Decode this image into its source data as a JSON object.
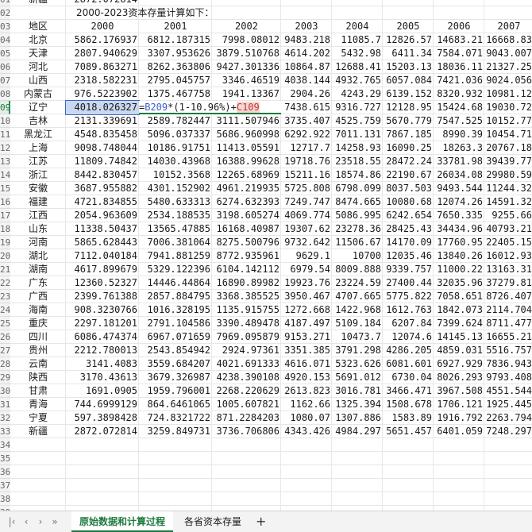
{
  "sheet": {
    "partial_top_row": {
      "rowlabel": "01",
      "cells": [
        "新疆",
        "2872.072814"
      ]
    },
    "title": "2000-2023资本存量计算如下：",
    "header": [
      "地区",
      "2000",
      "2001",
      "2002",
      "2003",
      "2004",
      "2005",
      "2006",
      "2007"
    ],
    "active_row": "09",
    "formula": {
      "a": "=",
      "b": "B209",
      "c": "*(1-10.96%)+",
      "d": "C109"
    },
    "rows": [
      {
        "n": "04",
        "cells": [
          "北京",
          "5862.176937",
          "6812.187315",
          "7998.08012",
          "9483.218",
          "11085.7",
          "12826.57",
          "14683.21",
          "16668.83"
        ]
      },
      {
        "n": "05",
        "cells": [
          "天津",
          "2807.940629",
          "3307.953626",
          "3879.510768",
          "4614.202",
          "5432.98",
          "6411.34",
          "7584.071",
          "9043.007"
        ]
      },
      {
        "n": "06",
        "cells": [
          "河北",
          "7089.863271",
          "8262.363806",
          "9427.301336",
          "10864.87",
          "12688.41",
          "15203.13",
          "18036.11",
          "21327.25"
        ]
      },
      {
        "n": "07",
        "cells": [
          "山西",
          "2318.582231",
          "2795.045757",
          "3346.46519",
          "4038.144",
          "4932.765",
          "6057.084",
          "7421.036",
          "9024.056"
        ]
      },
      {
        "n": "08",
        "cells": [
          "内蒙古",
          "976.5223902",
          "1375.467758",
          "1941.13367",
          "2904.26",
          "4243.29",
          "6139.152",
          "8320.932",
          "10981.12"
        ]
      },
      {
        "n": "09",
        "cells": [
          "辽宁",
          "4018.026327",
          "",
          "",
          "7438.615",
          "9316.727",
          "12128.95",
          "15424.68",
          "19030.72"
        ]
      },
      {
        "n": "10",
        "cells": [
          "吉林",
          "2131.339691",
          "2589.782447",
          "3111.507946",
          "3735.407",
          "4525.759",
          "5670.779",
          "7547.525",
          "10152.77"
        ]
      },
      {
        "n": "11",
        "cells": [
          "黑龙江",
          "4548.835458",
          "5096.037337",
          "5686.960998",
          "6292.922",
          "7011.131",
          "7867.185",
          "8990.39",
          "10454.71"
        ]
      },
      {
        "n": "12",
        "cells": [
          "上海",
          "9098.748044",
          "10186.91751",
          "11413.05591",
          "12717.7",
          "14258.93",
          "16090.25",
          "18263.3",
          "20767.18"
        ]
      },
      {
        "n": "13",
        "cells": [
          "江苏",
          "11809.74842",
          "14030.43968",
          "16388.99628",
          "19718.76",
          "23518.55",
          "28472.24",
          "33781.98",
          "39439.77"
        ]
      },
      {
        "n": "14",
        "cells": [
          "浙江",
          "8442.830457",
          "10152.3568",
          "12265.68969",
          "15211.16",
          "18574.86",
          "22190.67",
          "26034.08",
          "29980.59"
        ]
      },
      {
        "n": "15",
        "cells": [
          "安徽",
          "3687.955882",
          "4301.152902",
          "4961.219935",
          "5725.808",
          "6798.099",
          "8037.503",
          "9493.544",
          "11244.32"
        ]
      },
      {
        "n": "16",
        "cells": [
          "福建",
          "4721.834855",
          "5480.633313",
          "6274.632393",
          "7249.747",
          "8474.665",
          "10080.68",
          "12074.26",
          "14591.32"
        ]
      },
      {
        "n": "17",
        "cells": [
          "江西",
          "2054.963609",
          "2534.188535",
          "3198.605274",
          "4069.774",
          "5086.995",
          "6242.654",
          "7650.335",
          "9255.66"
        ]
      },
      {
        "n": "18",
        "cells": [
          "山东",
          "11338.50437",
          "13565.47885",
          "16168.40987",
          "19307.62",
          "23278.36",
          "28425.43",
          "34434.96",
          "40793.21"
        ]
      },
      {
        "n": "19",
        "cells": [
          "河南",
          "5865.628443",
          "7006.381064",
          "8275.500796",
          "9732.642",
          "11506.67",
          "14170.09",
          "17760.95",
          "22405.15"
        ]
      },
      {
        "n": "20",
        "cells": [
          "湖北",
          "7112.040184",
          "7941.881259",
          "8772.935961",
          "9629.1",
          "10700",
          "12035.46",
          "13840.26",
          "16012.93"
        ]
      },
      {
        "n": "21",
        "cells": [
          "湖南",
          "4617.899679",
          "5329.122396",
          "6104.142112",
          "6979.54",
          "8009.888",
          "9339.757",
          "11000.22",
          "13163.31"
        ]
      },
      {
        "n": "22",
        "cells": [
          "广东",
          "12360.52327",
          "14446.44864",
          "16890.89982",
          "19923.76",
          "23224.59",
          "27400.44",
          "32035.96",
          "37279.81"
        ]
      },
      {
        "n": "23",
        "cells": [
          "广西",
          "2399.761388",
          "2857.884795",
          "3368.385525",
          "3950.467",
          "4707.665",
          "5775.822",
          "7058.651",
          "8726.407"
        ]
      },
      {
        "n": "24",
        "cells": [
          "海南",
          "908.3230766",
          "1016.328195",
          "1135.915755",
          "1272.668",
          "1422.968",
          "1612.763",
          "1842.073",
          "2114.704"
        ]
      },
      {
        "n": "25",
        "cells": [
          "重庆",
          "2297.181201",
          "2791.104586",
          "3390.489478",
          "4187.497",
          "5109.184",
          "6207.84",
          "7399.624",
          "8711.477"
        ]
      },
      {
        "n": "26",
        "cells": [
          "四川",
          "6086.474374",
          "6967.071659",
          "7969.095879",
          "9153.271",
          "10473.7",
          "12074.6",
          "14145.13",
          "16655.21"
        ]
      },
      {
        "n": "27",
        "cells": [
          "贵州",
          "2212.780013",
          "2543.854942",
          "2924.97361",
          "3351.385",
          "3791.298",
          "4286.205",
          "4859.031",
          "5516.757"
        ]
      },
      {
        "n": "28",
        "cells": [
          "云南",
          "3141.4083",
          "3559.684207",
          "4021.691333",
          "4616.071",
          "5323.626",
          "6081.601",
          "6927.929",
          "7836.943"
        ]
      },
      {
        "n": "29",
        "cells": [
          "陕西",
          "3170.43613",
          "3679.326987",
          "4238.390108",
          "4920.153",
          "5691.012",
          "6730.04",
          "8026.293",
          "9793.408"
        ]
      },
      {
        "n": "30",
        "cells": [
          "甘肃",
          "1691.0905",
          "1959.796001",
          "2268.220629",
          "2613.823",
          "3016.781",
          "3466.471",
          "3967.508",
          "4551.544"
        ]
      },
      {
        "n": "31",
        "cells": [
          "青海",
          "744.6999129",
          "864.6461065",
          "1005.607821",
          "1162.66",
          "1325.394",
          "1508.678",
          "1706.121",
          "1925.445"
        ]
      },
      {
        "n": "32",
        "cells": [
          "宁夏",
          "597.3898428",
          "724.8321722",
          "871.2284203",
          "1080.07",
          "1307.886",
          "1583.89",
          "1916.792",
          "2263.794"
        ]
      },
      {
        "n": "33",
        "cells": [
          "新疆",
          "2872.072814",
          "3259.849731",
          "3736.706806",
          "4343.426",
          "4984.297",
          "5651.457",
          "6401.059",
          "7248.297"
        ]
      }
    ],
    "empty_rows": [
      "34",
      "35",
      "36",
      "37",
      "38",
      "39"
    ]
  },
  "tabs": {
    "nav": [
      "‹",
      "›",
      "»"
    ],
    "items": [
      {
        "label": "原始数据和计算过程",
        "active": true
      },
      {
        "label": "各省资本存量",
        "active": false
      }
    ],
    "add": "+"
  },
  "colors": {
    "accent": "#1d7a3e",
    "selection": "#c9d7ef",
    "ref_blue": "#3b5fc9",
    "ref_red": "#c0392b"
  }
}
